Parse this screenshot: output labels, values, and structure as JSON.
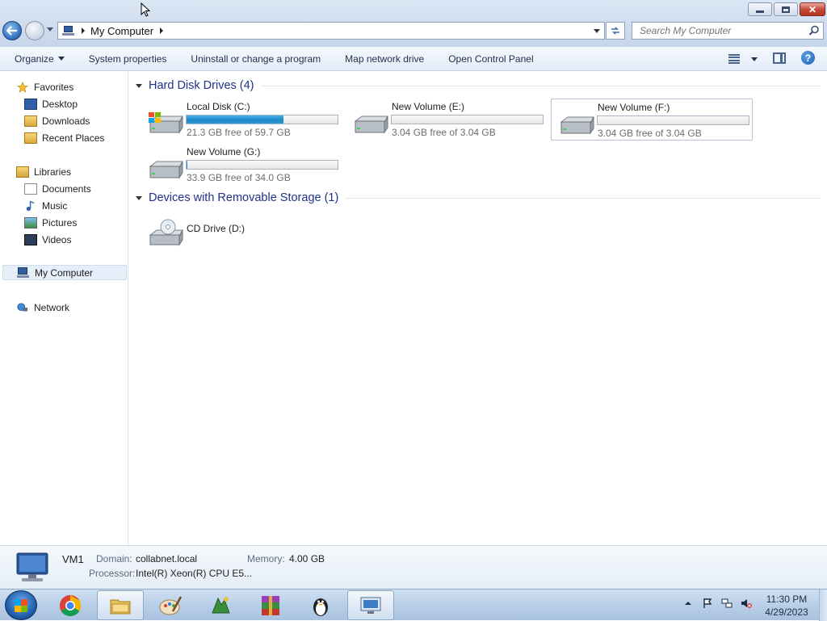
{
  "window": {
    "title": "My Computer",
    "controls": {
      "minimize": "–",
      "maximize": "□",
      "close": "✕"
    }
  },
  "address_bar": {
    "location": "My Computer",
    "icon": "computer-icon"
  },
  "search": {
    "placeholder": "Search My Computer"
  },
  "command_bar": {
    "organize": "Organize",
    "system_properties": "System properties",
    "uninstall": "Uninstall or change a program",
    "map_drive": "Map network drive",
    "control_panel": "Open Control Panel",
    "help": "?"
  },
  "nav_pane": {
    "favorites": {
      "label": "Favorites",
      "items": [
        {
          "label": "Desktop",
          "icon": "desktop-icon"
        },
        {
          "label": "Downloads",
          "icon": "downloads-icon"
        },
        {
          "label": "Recent Places",
          "icon": "recent-places-icon"
        }
      ]
    },
    "libraries": {
      "label": "Libraries",
      "items": [
        {
          "label": "Documents",
          "icon": "documents-icon"
        },
        {
          "label": "Music",
          "icon": "music-icon"
        },
        {
          "label": "Pictures",
          "icon": "pictures-icon"
        },
        {
          "label": "Videos",
          "icon": "videos-icon"
        }
      ]
    },
    "computer": {
      "label": "My Computer",
      "selected": true
    },
    "network": {
      "label": "Network"
    }
  },
  "content": {
    "hard_disks": {
      "title": "Hard Disk Drives (4)",
      "drives": [
        {
          "name": "Local Disk (C:)",
          "free": "21.3 GB free of 59.7 GB",
          "used_fraction": 0.643,
          "windows_logo": true
        },
        {
          "name": "New Volume (E:)",
          "free": "3.04 GB free of 3.04 GB",
          "used_fraction": 0.0
        },
        {
          "name": "New Volume (F:)",
          "free": "3.04 GB free of 3.04 GB",
          "used_fraction": 0.0,
          "selected": true
        },
        {
          "name": "New Volume (G:)",
          "free": "33.9 GB free of 34.0 GB",
          "used_fraction": 0.003
        }
      ]
    },
    "removable": {
      "title": "Devices with Removable Storage (1)",
      "drives": [
        {
          "name": "CD Drive (D:)"
        }
      ]
    }
  },
  "details": {
    "name": "VM1",
    "domain_label": "Domain:",
    "domain": "collabnet.local",
    "memory_label": "Memory:",
    "memory": "4.00 GB",
    "processor_label": "Processor:",
    "processor": "Intel(R) Xeon(R) CPU E5..."
  },
  "taskbar": {
    "apps": [
      "chrome-icon",
      "explorer-icon",
      "paint-icon",
      "app-icon",
      "winrar-icon",
      "penguin-icon",
      "remote-desktop-icon"
    ],
    "clock_time": "11:30 PM",
    "clock_date": "4/29/2023"
  },
  "colors": {
    "group_title": "#1e3287",
    "usage_bar": "#1e89c9",
    "selection": "#e5eef9"
  }
}
